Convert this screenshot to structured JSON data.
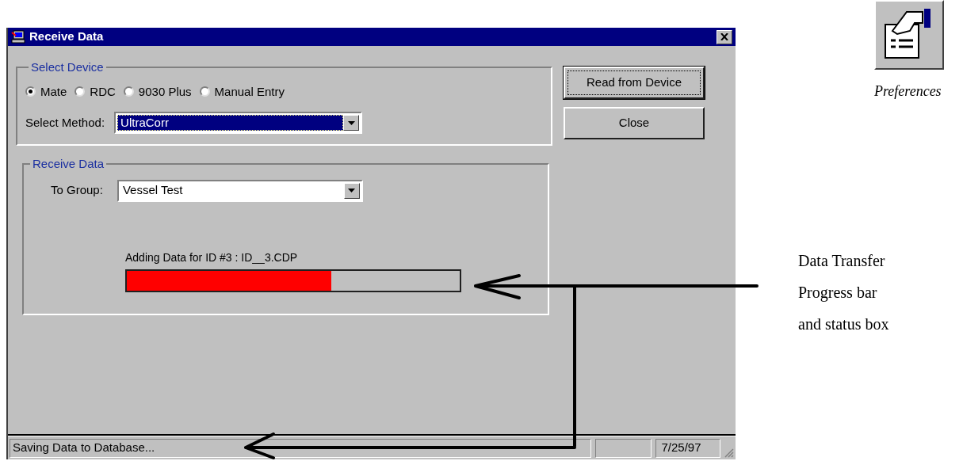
{
  "window": {
    "title": "Receive Data"
  },
  "select_device": {
    "legend": "Select Device",
    "devices": [
      {
        "label": "Mate",
        "selected": true
      },
      {
        "label": "RDC",
        "selected": false
      },
      {
        "label": "9030 Plus",
        "selected": false
      },
      {
        "label": "Manual Entry",
        "selected": false
      }
    ],
    "method": {
      "label": "Select Method:",
      "value": "UltraCorr",
      "focused": true
    }
  },
  "receive_data": {
    "legend": "Receive Data",
    "group": {
      "label": "To Group:",
      "value": "Vessel Test",
      "focused": false
    },
    "progress": {
      "label": "Adding Data for ID #3 : ID__3.CDP",
      "level": 0.615
    }
  },
  "buttons": [
    {
      "label": "Read from Device",
      "default": true
    },
    {
      "label": "Close",
      "default": false
    }
  ],
  "status_bar": {
    "message": "Saving Data to Database...",
    "date": "7/25/97"
  },
  "preferences": {
    "label": "Preferences"
  },
  "annotation": {
    "lines": [
      "Data Transfer",
      "Progress bar",
      "and status box"
    ]
  }
}
